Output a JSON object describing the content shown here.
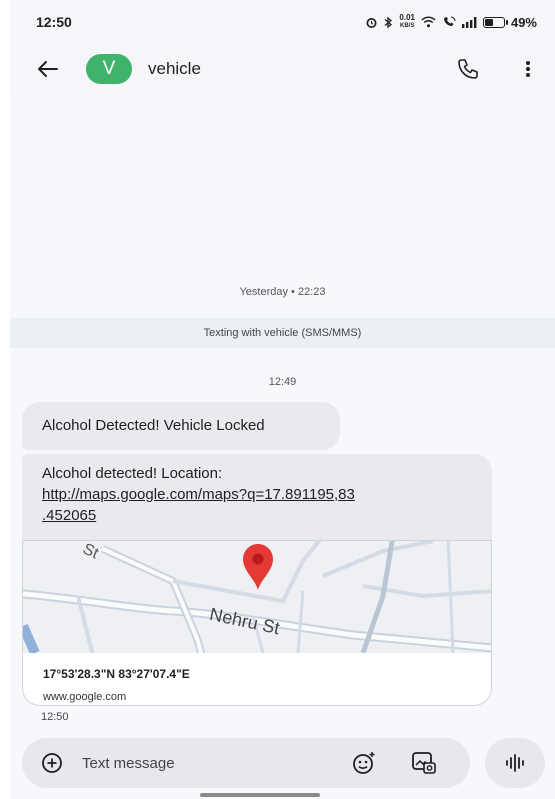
{
  "status_bar": {
    "time": "12:50",
    "net_speed_value": "0.01",
    "net_speed_unit": "KB/S",
    "battery_percent": "49%",
    "battery_level": 0.49
  },
  "app_bar": {
    "avatar_letter": "V",
    "avatar_color": "#3fb36b",
    "contact_name": "vehicle"
  },
  "conversation": {
    "date_separator": "Yesterday • 22:23",
    "texting_banner": "Texting with vehicle (SMS/MMS)",
    "time_separator": "12:49",
    "messages": [
      {
        "text": "Alcohol Detected! Vehicle Locked"
      },
      {
        "text": "Alcohol detected! Location:",
        "link": "http://maps.google.com/maps?q=17.891195,83.452065",
        "link_line1": "http://maps.google.com/maps?q=17.891195,83",
        "link_line2": ".452065",
        "preview": {
          "street_top": "St",
          "street_main": "Nehru St",
          "coordinates": "17°53'28.3\"N 83°27'07.4\"E",
          "domain": "www.google.com"
        }
      }
    ],
    "last_time": "12:50"
  },
  "compose": {
    "placeholder": "Text message",
    "icons": [
      "add-icon",
      "emoji-icon",
      "gallery-icon",
      "voice-icon"
    ]
  },
  "colors": {
    "bubble": "#e9e9ee",
    "map_pin": "#e53935",
    "background": "#f7f8fb"
  }
}
